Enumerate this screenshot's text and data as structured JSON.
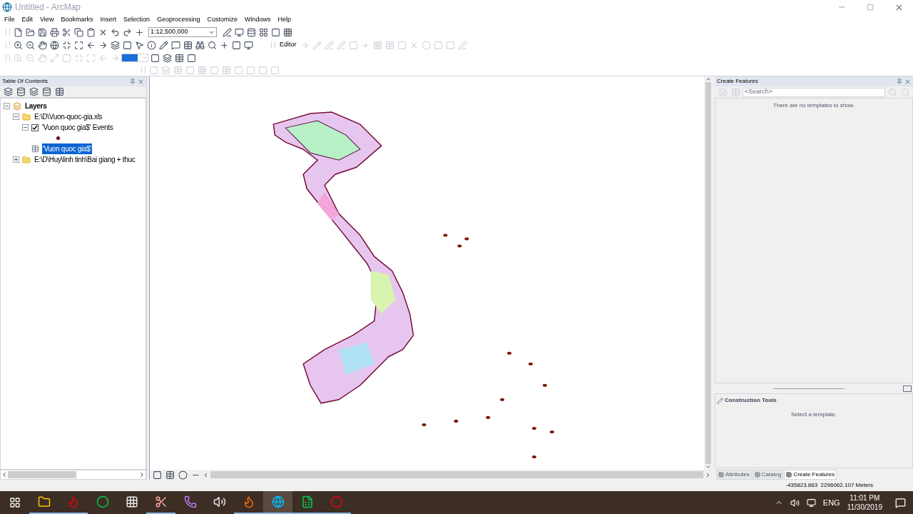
{
  "window": {
    "title": "Untitled - ArcMap"
  },
  "menu": [
    "File",
    "Edit",
    "View",
    "Bookmarks",
    "Insert",
    "Selection",
    "Geoprocessing",
    "Customize",
    "Windows",
    "Help"
  ],
  "toolbar": {
    "scale": "1:12,500,000",
    "editor": "Editor"
  },
  "toc": {
    "title": "Table Of Contents",
    "root": {
      "label": "Layers",
      "expanded": true,
      "children": [
        {
          "label": "E:\\D\\Vuon-quoc-gia.xls",
          "expanded": true,
          "children": [
            {
              "label": "'Vuon quoc gia$' Events",
              "expanded": true,
              "checked": true,
              "kind": "layer"
            },
            {
              "label": "'Vuon quoc gia$'",
              "selected": true,
              "kind": "table"
            }
          ]
        },
        {
          "label": "E:\\D\\Huy\\linh tinh\\Bai giang + thuc",
          "expanded": false
        }
      ]
    }
  },
  "create_features": {
    "title": "Create Features",
    "search_placeholder": "<Search>",
    "empty_message": "There are no templates to show.",
    "construction_title": "Construction Tools",
    "construction_message": "Select a template."
  },
  "bottom_tabs": [
    {
      "label": "Attributes",
      "selected": false
    },
    {
      "label": "Catalog",
      "selected": false
    },
    {
      "label": "Create Features",
      "selected": true
    }
  ],
  "status_bar": {
    "coordinates": "-435823.863  2296062.107 Meters"
  },
  "taskbar": {
    "apps": [
      {
        "kind": "folder",
        "running": true,
        "selected": false
      },
      {
        "kind": "garena",
        "running": true,
        "selected": false
      },
      {
        "kind": "coccoc",
        "running": false,
        "selected": false
      },
      {
        "kind": "unikey",
        "running": false,
        "selected": false
      },
      {
        "kind": "snip",
        "running": true,
        "selected": false
      },
      {
        "kind": "viber",
        "running": false,
        "selected": false
      },
      {
        "kind": "speaker",
        "running": false,
        "selected": false
      },
      {
        "kind": "firefox",
        "running": true,
        "selected": false
      },
      {
        "kind": "arcmap",
        "running": true,
        "selected": true
      },
      {
        "kind": "excel",
        "running": true,
        "selected": false
      },
      {
        "kind": "record",
        "running": true,
        "selected": false
      }
    ],
    "language": "ENG",
    "time": "11:01 PM",
    "date": "11/30/2019"
  }
}
